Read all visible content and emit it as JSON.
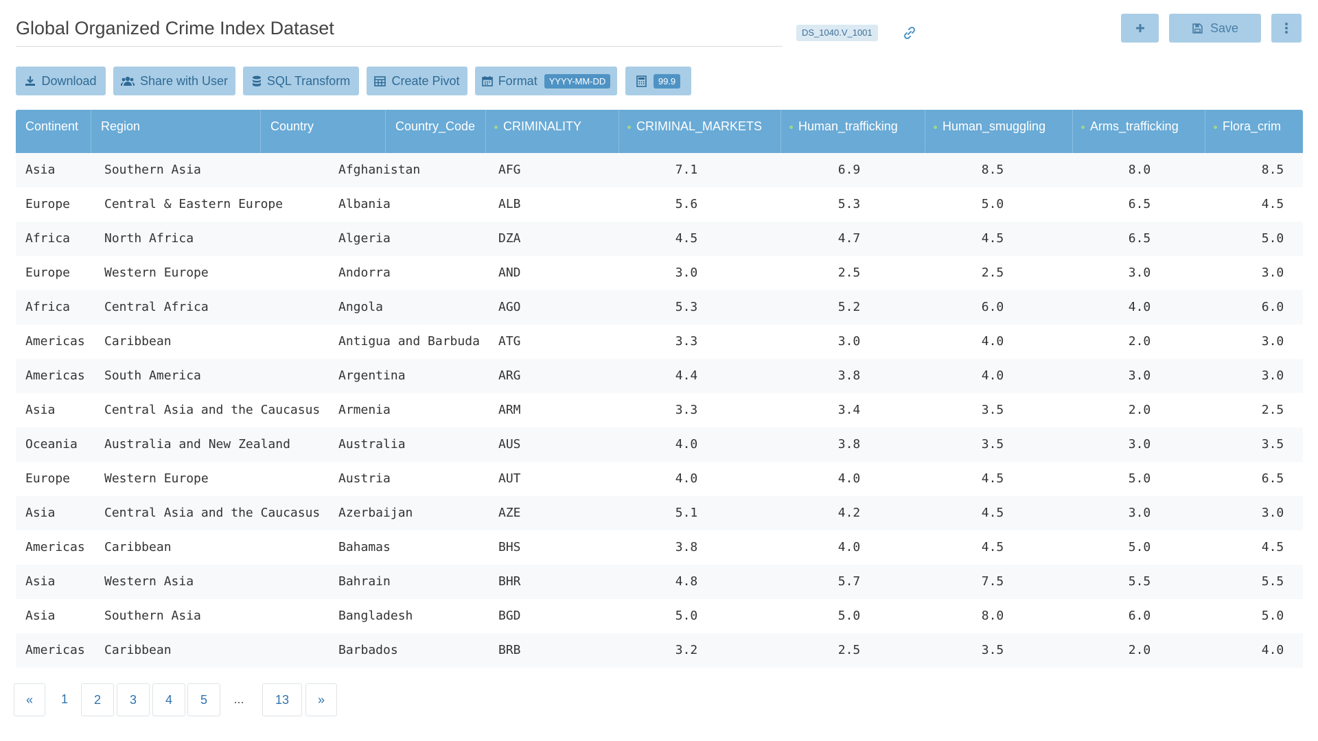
{
  "header": {
    "title": "Global Organized Crime Index Dataset",
    "dataset_id": "DS_1040.V_1001",
    "save_label": "Save",
    "plus_icon": "plus-icon",
    "save_icon": "floppy-disk-icon",
    "more_icon": "vertical-ellipsis-icon",
    "link_icon": "link-icon"
  },
  "toolbar": {
    "download_label": "Download",
    "share_label": "Share with User",
    "sql_label": "SQL Transform",
    "pivot_label": "Create Pivot",
    "format_label": "Format",
    "format_value": "YYYY-MM-DD",
    "decimal_value": "99.9"
  },
  "colors": {
    "accent": "#69aad6",
    "button_bg": "#a9cde6",
    "button_text": "#2f6a95",
    "badge_bg": "#4f93c4",
    "sort_dot": "#9fd58f"
  },
  "table": {
    "columns": [
      {
        "label": "Continent",
        "sortable": false
      },
      {
        "label": "Region",
        "sortable": false
      },
      {
        "label": "Country",
        "sortable": false
      },
      {
        "label": "Country_Code",
        "sortable": false
      },
      {
        "label": "CRIMINALITY",
        "sortable": true
      },
      {
        "label": "CRIMINAL_MARKETS",
        "sortable": true
      },
      {
        "label": "Human_trafficking",
        "sortable": true
      },
      {
        "label": "Human_smuggling",
        "sortable": true
      },
      {
        "label": "Arms_trafficking",
        "sortable": true
      },
      {
        "label": "Flora_crim",
        "sortable": true
      }
    ],
    "rows": [
      [
        "Asia",
        "Southern Asia",
        "Afghanistan",
        "AFG",
        "7.1",
        "6.9",
        "8.5",
        "8.0",
        "8.5"
      ],
      [
        "Europe",
        "Central & Eastern Europe",
        "Albania",
        "ALB",
        "5.6",
        "5.3",
        "5.0",
        "6.5",
        "4.5"
      ],
      [
        "Africa",
        "North Africa",
        "Algeria",
        "DZA",
        "4.5",
        "4.7",
        "4.5",
        "6.5",
        "5.0"
      ],
      [
        "Europe",
        "Western Europe",
        "Andorra",
        "AND",
        "3.0",
        "2.5",
        "2.5",
        "3.0",
        "3.0"
      ],
      [
        "Africa",
        "Central Africa",
        "Angola",
        "AGO",
        "5.3",
        "5.2",
        "6.0",
        "4.0",
        "6.0"
      ],
      [
        "Americas",
        "Caribbean",
        "Antigua and Barbuda",
        "ATG",
        "3.3",
        "3.0",
        "4.0",
        "2.0",
        "3.0"
      ],
      [
        "Americas",
        "South America",
        "Argentina",
        "ARG",
        "4.4",
        "3.8",
        "4.0",
        "3.0",
        "3.0"
      ],
      [
        "Asia",
        "Central Asia and the Caucasus",
        "Armenia",
        "ARM",
        "3.3",
        "3.4",
        "3.5",
        "2.0",
        "2.5"
      ],
      [
        "Oceania",
        "Australia and New Zealand",
        "Australia",
        "AUS",
        "4.0",
        "3.8",
        "3.5",
        "3.0",
        "3.5"
      ],
      [
        "Europe",
        "Western Europe",
        "Austria",
        "AUT",
        "4.0",
        "4.0",
        "4.5",
        "5.0",
        "6.5"
      ],
      [
        "Asia",
        "Central Asia and the Caucasus",
        "Azerbaijan",
        "AZE",
        "5.1",
        "4.2",
        "4.5",
        "3.0",
        "3.0"
      ],
      [
        "Americas",
        "Caribbean",
        "Bahamas",
        "BHS",
        "3.8",
        "4.0",
        "4.5",
        "5.0",
        "4.5"
      ],
      [
        "Asia",
        "Western Asia",
        "Bahrain",
        "BHR",
        "4.8",
        "5.7",
        "7.5",
        "5.5",
        "5.5"
      ],
      [
        "Asia",
        "Southern Asia",
        "Bangladesh",
        "BGD",
        "5.0",
        "5.0",
        "8.0",
        "6.0",
        "5.0"
      ],
      [
        "Americas",
        "Caribbean",
        "Barbados",
        "BRB",
        "3.2",
        "2.5",
        "3.5",
        "2.0",
        "4.0"
      ]
    ]
  },
  "pagination": {
    "prev": "«",
    "pages": [
      "1",
      "2",
      "3",
      "4",
      "5"
    ],
    "ellipsis": "...",
    "last": "13",
    "next": "»",
    "current": "1"
  }
}
